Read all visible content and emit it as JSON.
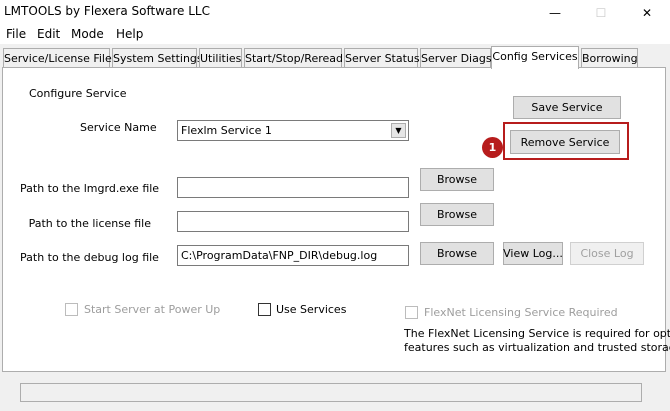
{
  "window": {
    "title": "LMTOOLS by Flexera Software LLC",
    "controls": {
      "minimize": "—",
      "maximize": "☐",
      "close": "✕"
    }
  },
  "menu": [
    "File",
    "Edit",
    "Mode",
    "Help"
  ],
  "tabs": [
    "Service/License File",
    "System Settings",
    "Utilities",
    "Start/Stop/Reread",
    "Server Status",
    "Server Diags",
    "Config Services",
    "Borrowing"
  ],
  "active_tab": "Config Services",
  "config": {
    "group_label": "Configure Service",
    "service_name_label": "Service Name",
    "service_name_value": "Flexlm Service 1",
    "lmgrd_label": "Path to the lmgrd.exe file",
    "lmgrd_value": "",
    "license_label": "Path to the license file",
    "license_value": "",
    "debug_label": "Path to the debug log file",
    "debug_value": "C:\\ProgramData\\FNP_DIR\\debug.log",
    "browse_label": "Browse",
    "save_label": "Save Service",
    "remove_label": "Remove Service",
    "view_log_label": "View Log...",
    "close_log_label": "Close Log",
    "start_power_up_label": "Start Server at Power Up",
    "use_services_label": "Use Services",
    "flexnet_required_label": "FlexNet Licensing Service Required",
    "flexnet_note_line1": "The FlexNet Licensing Service is required for optional",
    "flexnet_note_line2": "features such as virtualization and trusted storage."
  },
  "annotation": {
    "number": "1",
    "color": "#b71c1c"
  },
  "icons": {
    "dropdown": "chevron-down-icon"
  }
}
